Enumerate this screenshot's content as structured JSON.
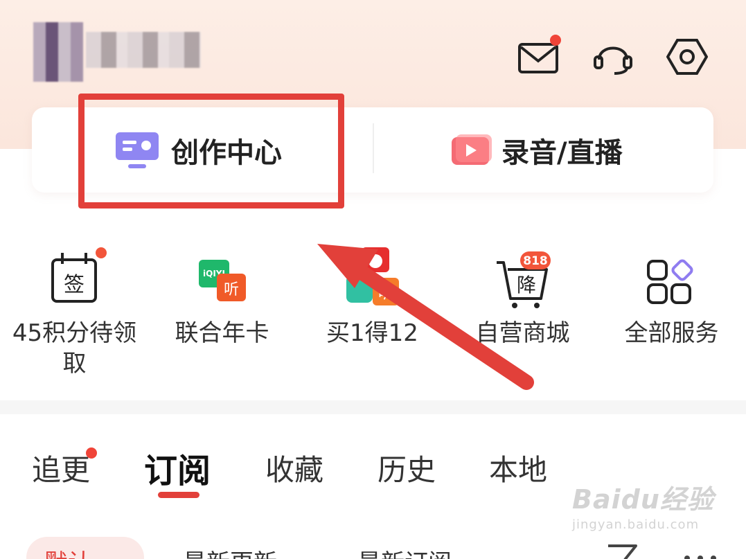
{
  "header": {
    "icons": [
      "mail-icon",
      "customer-service-icon",
      "settings-icon"
    ],
    "mail_has_dot": true
  },
  "top_card": {
    "create_center_label": "创作中心",
    "record_live_label": "录音/直播"
  },
  "grid": [
    {
      "label": "45积分待领取",
      "icon_text": "签"
    },
    {
      "label": "联合年卡",
      "icon_text": "iQIYI"
    },
    {
      "label": "买1得12",
      "icon_text": "听"
    },
    {
      "label": "自营商城",
      "icon_text": "降",
      "badge": "818"
    },
    {
      "label": "全部服务"
    }
  ],
  "tabs": [
    {
      "label": "追更"
    },
    {
      "label": "订阅"
    },
    {
      "label": "收藏"
    },
    {
      "label": "历史"
    },
    {
      "label": "本地"
    }
  ],
  "filters": [
    {
      "label": "默认"
    },
    {
      "label": "最新更新"
    },
    {
      "label": "最新订阅"
    }
  ],
  "watermark": {
    "brand": "Baidu经验",
    "url": "jingyan.baidu.com"
  },
  "colors": {
    "accent": "#e2403a",
    "header_bg": "#fdeee6"
  }
}
